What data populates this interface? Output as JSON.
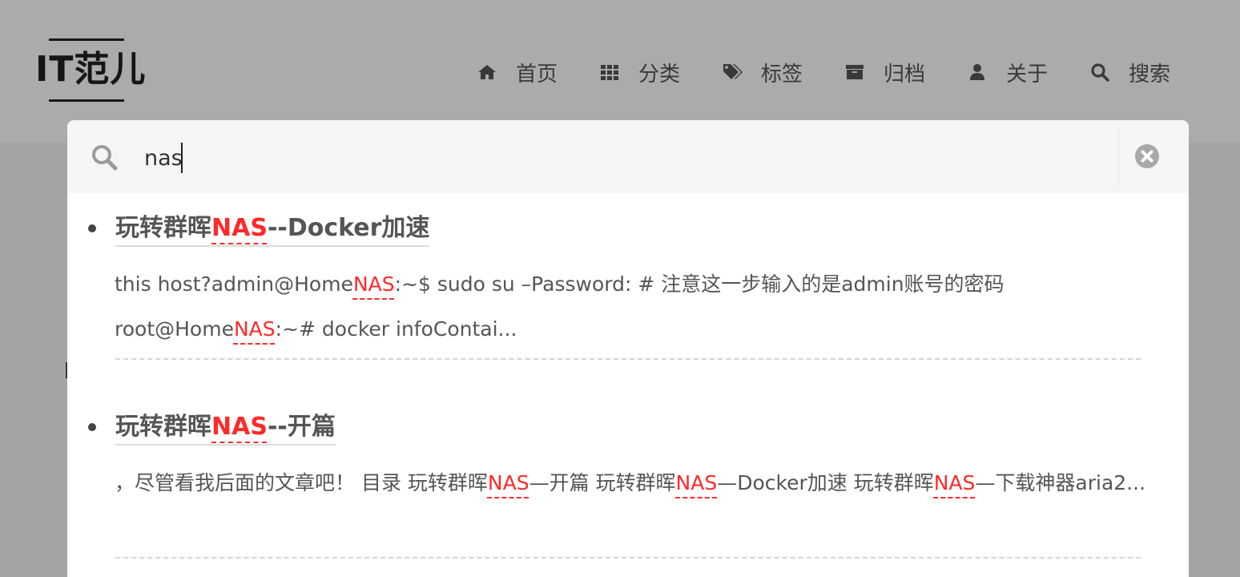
{
  "site": {
    "logo": "IT范儿"
  },
  "nav": {
    "items": [
      {
        "label": "首页",
        "icon": "home-icon"
      },
      {
        "label": "分类",
        "icon": "grid-icon"
      },
      {
        "label": "标签",
        "icon": "tags-icon"
      },
      {
        "label": "归档",
        "icon": "archive-icon"
      },
      {
        "label": "关于",
        "icon": "user-icon"
      },
      {
        "label": "搜索",
        "icon": "search-icon"
      }
    ]
  },
  "search": {
    "query": "nas",
    "icon": "search-icon",
    "close_icon": "close-circle-icon"
  },
  "results": [
    {
      "title_parts": [
        "玩转群晖",
        "NAS",
        "--Docker加速"
      ],
      "snippet_parts": [
        "this host?admin@Home",
        "NAS",
        ":~$ sudo su –Password: # 注意这一步输入的是admin账号的密码 root@Home",
        "NAS",
        ":~# docker infoContai..."
      ]
    },
    {
      "title_parts": [
        "玩转群晖",
        "NAS",
        "--开篇"
      ],
      "snippet_parts": [
        "，尽管看我后面的文章吧！  目录 玩转群晖",
        "NAS",
        "—开篇 玩转群晖",
        "NAS",
        "—Docker加速 玩转群晖",
        "NAS",
        "—下载神器aria2..."
      ]
    }
  ],
  "colors": {
    "highlight": "#ff2a2a",
    "text": "#555555",
    "search_bar_bg": "#f5f5f5"
  }
}
